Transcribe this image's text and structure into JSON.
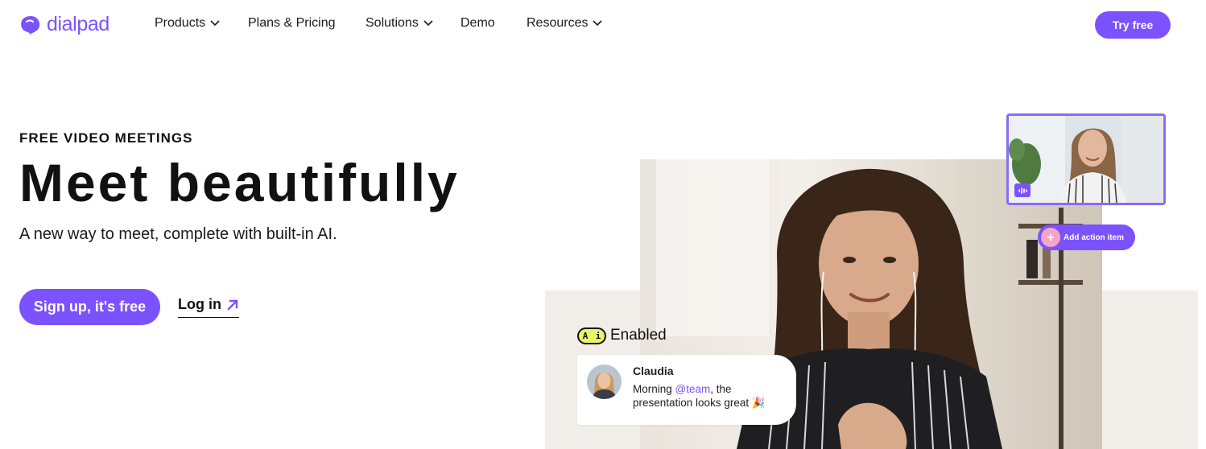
{
  "brand": {
    "name": "dialpad",
    "color": "#7c52ff"
  },
  "nav": {
    "items": [
      {
        "label": "Products",
        "has_dropdown": true
      },
      {
        "label": "Plans & Pricing",
        "has_dropdown": false
      },
      {
        "label": "Solutions",
        "has_dropdown": true
      },
      {
        "label": "Demo",
        "has_dropdown": false
      },
      {
        "label": "Resources",
        "has_dropdown": true
      }
    ],
    "cta_label": "Try free"
  },
  "hero": {
    "eyebrow": "FREE VIDEO MEETINGS",
    "title": "Meet beautifully",
    "subtitle": "A new way to meet, complete with built-in AI.",
    "primary_cta": "Sign up, it's free",
    "secondary_cta": "Log in"
  },
  "visual": {
    "action_item_label": "Add action item",
    "ai_badge": {
      "left": "A",
      "right": "i"
    },
    "ai_status": "Enabled",
    "chat": {
      "name": "Claudia",
      "message_before": "Morning ",
      "mention": "@team",
      "message_after": ", the presentation looks great 🎉"
    }
  },
  "colors": {
    "accent": "#7c52ff",
    "ai_yellow": "#e6f56a",
    "pill_pink": "#f4a6c6",
    "beige": "#f1eee9"
  }
}
